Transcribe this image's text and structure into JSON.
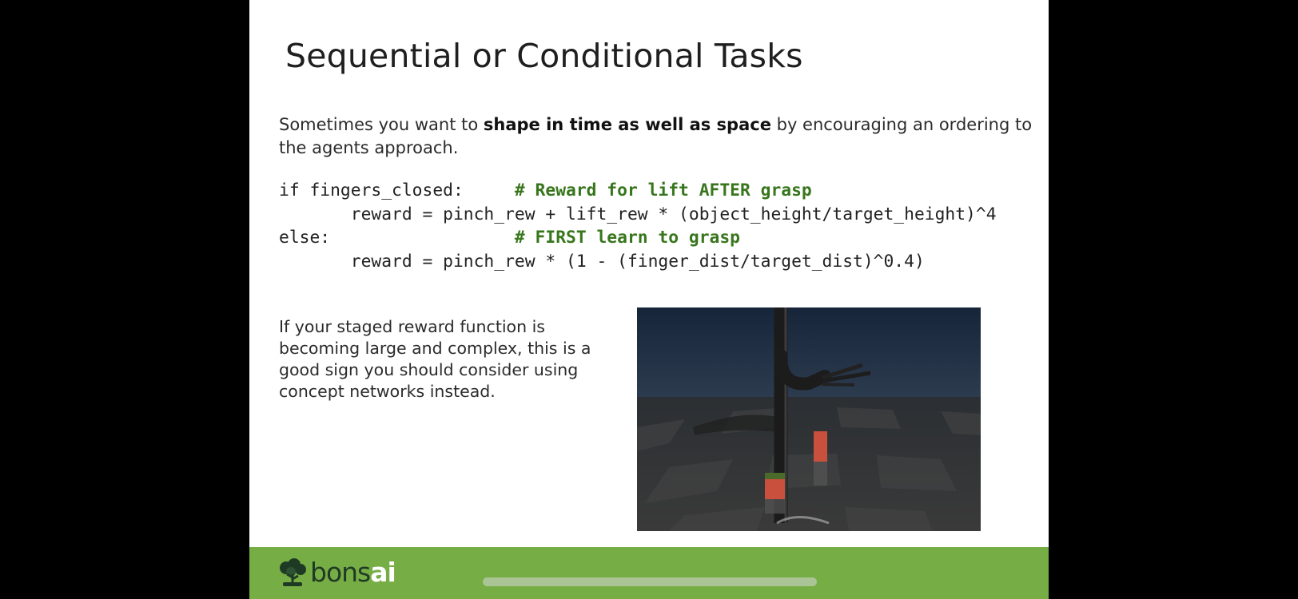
{
  "slide": {
    "title": "Sequential or Conditional Tasks",
    "intro": {
      "before": "Sometimes you want to ",
      "bold": "shape in time as well as space",
      "after": " by encouraging an ordering to the agents approach."
    },
    "code": {
      "line1_code": "if fingers_closed:     ",
      "line1_comment": "# Reward for lift AFTER grasp",
      "line2_code": "       reward = pinch_rew + lift_rew * (object_height/target_height)^4",
      "line3_code": "else:                  ",
      "line3_comment": "# FIRST learn to grasp",
      "line4_code": "       reward = pinch_rew * (1 - (finger_dist/target_dist)^0.4)"
    },
    "note": "If your staged reward function is becoming large and complex, this is a good sign you should consider using concept networks instead."
  },
  "footer": {
    "logo_text_1": "bons",
    "logo_text_2": "ai",
    "logo_icon": "bonsai-tree-icon",
    "color": "#77ad45"
  }
}
